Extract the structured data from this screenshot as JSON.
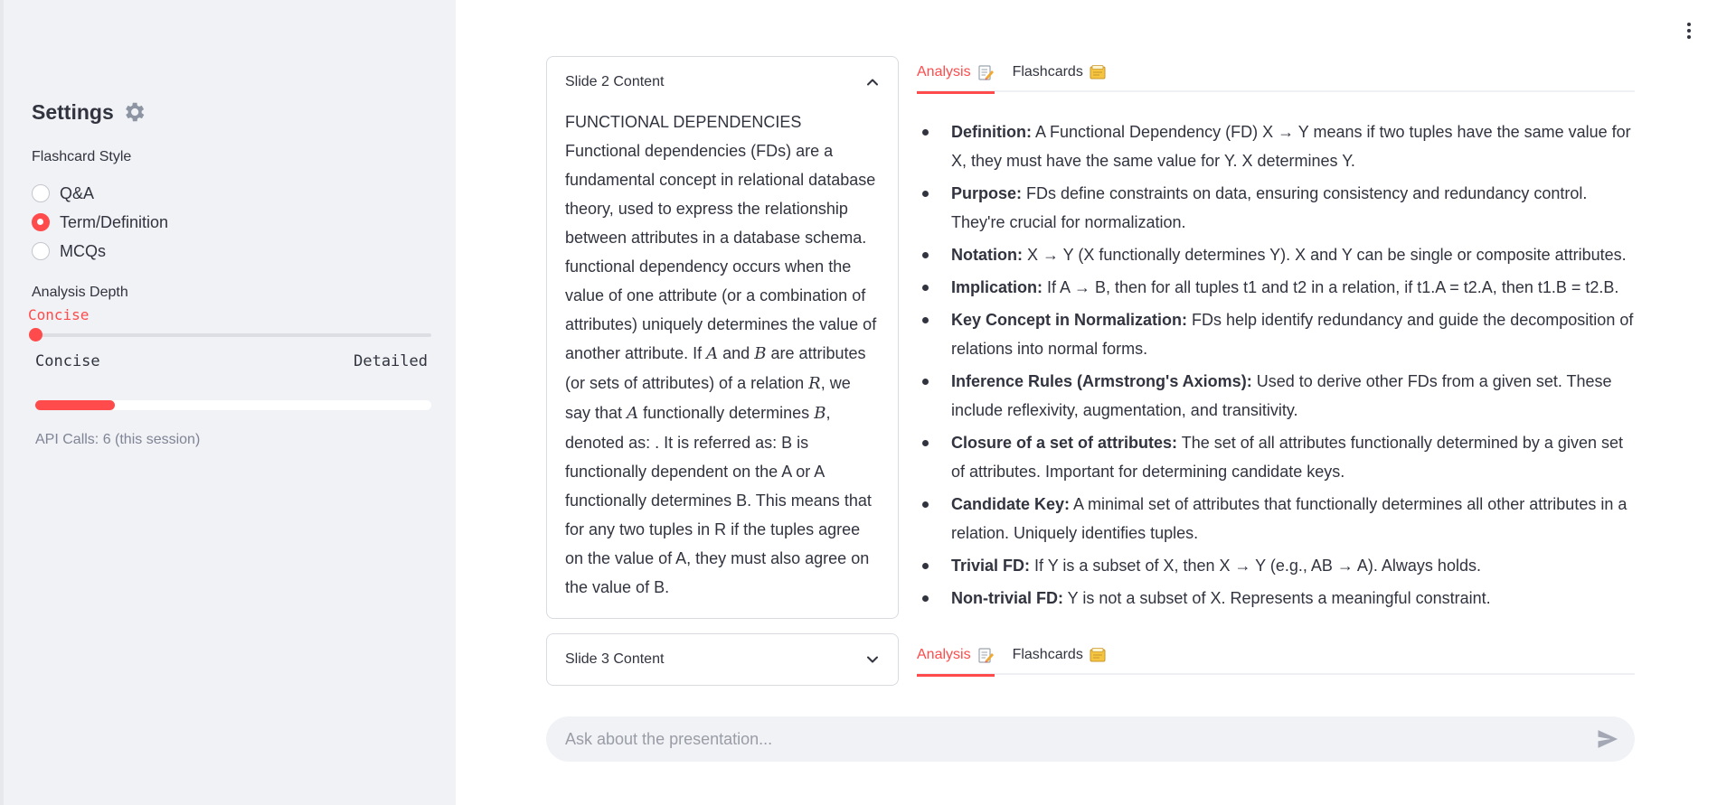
{
  "sidebar": {
    "title": "Settings",
    "flashcard_style": {
      "label": "Flashcard Style",
      "options": [
        "Q&A",
        "Term/Definition",
        "MCQs"
      ],
      "selected": "Term/Definition"
    },
    "analysis_depth": {
      "label": "Analysis Depth",
      "value": "Concise",
      "min_label": "Concise",
      "max_label": "Detailed",
      "level": 0
    },
    "progress": 0.2,
    "api_calls": "API Calls: 6 (this session)"
  },
  "slide2": {
    "title": "Slide 2 Content",
    "p1": "FUNCTIONAL DEPENDENCIES Functional dependencies (FDs) are a fundamental concept in relational database theory, used to express the relationship between attributes in a database schema. functional dependency occurs when the value of one attribute (or a combination of attributes) uniquely determines the value of another attribute. If",
    "var_a": "A",
    "and": "and",
    "var_b": "B",
    "p2": "are attributes (or sets of attributes) of a relation",
    "var_r": "R",
    "p3": ", we say that",
    "p4": "functionally determines",
    "p5": ", denoted as: . It is referred as: B is functionally dependent on the A or A functionally determines B. This means that for any two tuples in R if the tuples agree on the value of A, they must also agree on the value of B."
  },
  "slide3": {
    "title": "Slide 3 Content"
  },
  "tabs": {
    "analysis": "Analysis",
    "flashcards": "Flashcards"
  },
  "analysis_points": [
    {
      "term": "Definition:",
      "text": " A Functional Dependency (FD) X → Y means if two tuples have the same value for X, they must have the same value for Y. X determines Y."
    },
    {
      "term": "Purpose:",
      "text": " FDs define constraints on data, ensuring consistency and redundancy control. They're crucial for normalization."
    },
    {
      "term": "Notation:",
      "text": " X → Y (X functionally determines Y). X and Y can be single or composite attributes."
    },
    {
      "term": "Implication:",
      "text": " If A → B, then for all tuples t1 and t2 in a relation, if t1.A = t2.A, then t1.B = t2.B."
    },
    {
      "term": "Key Concept in Normalization:",
      "text": " FDs help identify redundancy and guide the decomposition of relations into normal forms."
    },
    {
      "term": "Inference Rules (Armstrong's Axioms):",
      "text": " Used to derive other FDs from a given set. These include reflexivity, augmentation, and transitivity."
    },
    {
      "term": "Closure of a set of attributes:",
      "text": " The set of all attributes functionally determined by a given set of attributes. Important for determining candidate keys."
    },
    {
      "term": "Candidate Key:",
      "text": " A minimal set of attributes that functionally determines all other attributes in a relation. Uniquely identifies tuples."
    },
    {
      "term": "Trivial FD:",
      "text": " If Y is a subset of X, then X → Y (e.g., AB → A). Always holds."
    },
    {
      "term": "Non-trivial FD:",
      "text": " Y is not a subset of X. Represents a meaningful constraint."
    }
  ],
  "chat": {
    "placeholder": "Ask about the presentation..."
  },
  "colors": {
    "accent": "#ff4b4b",
    "sidebar_bg": "#f0f2f6",
    "text": "#31333f"
  }
}
